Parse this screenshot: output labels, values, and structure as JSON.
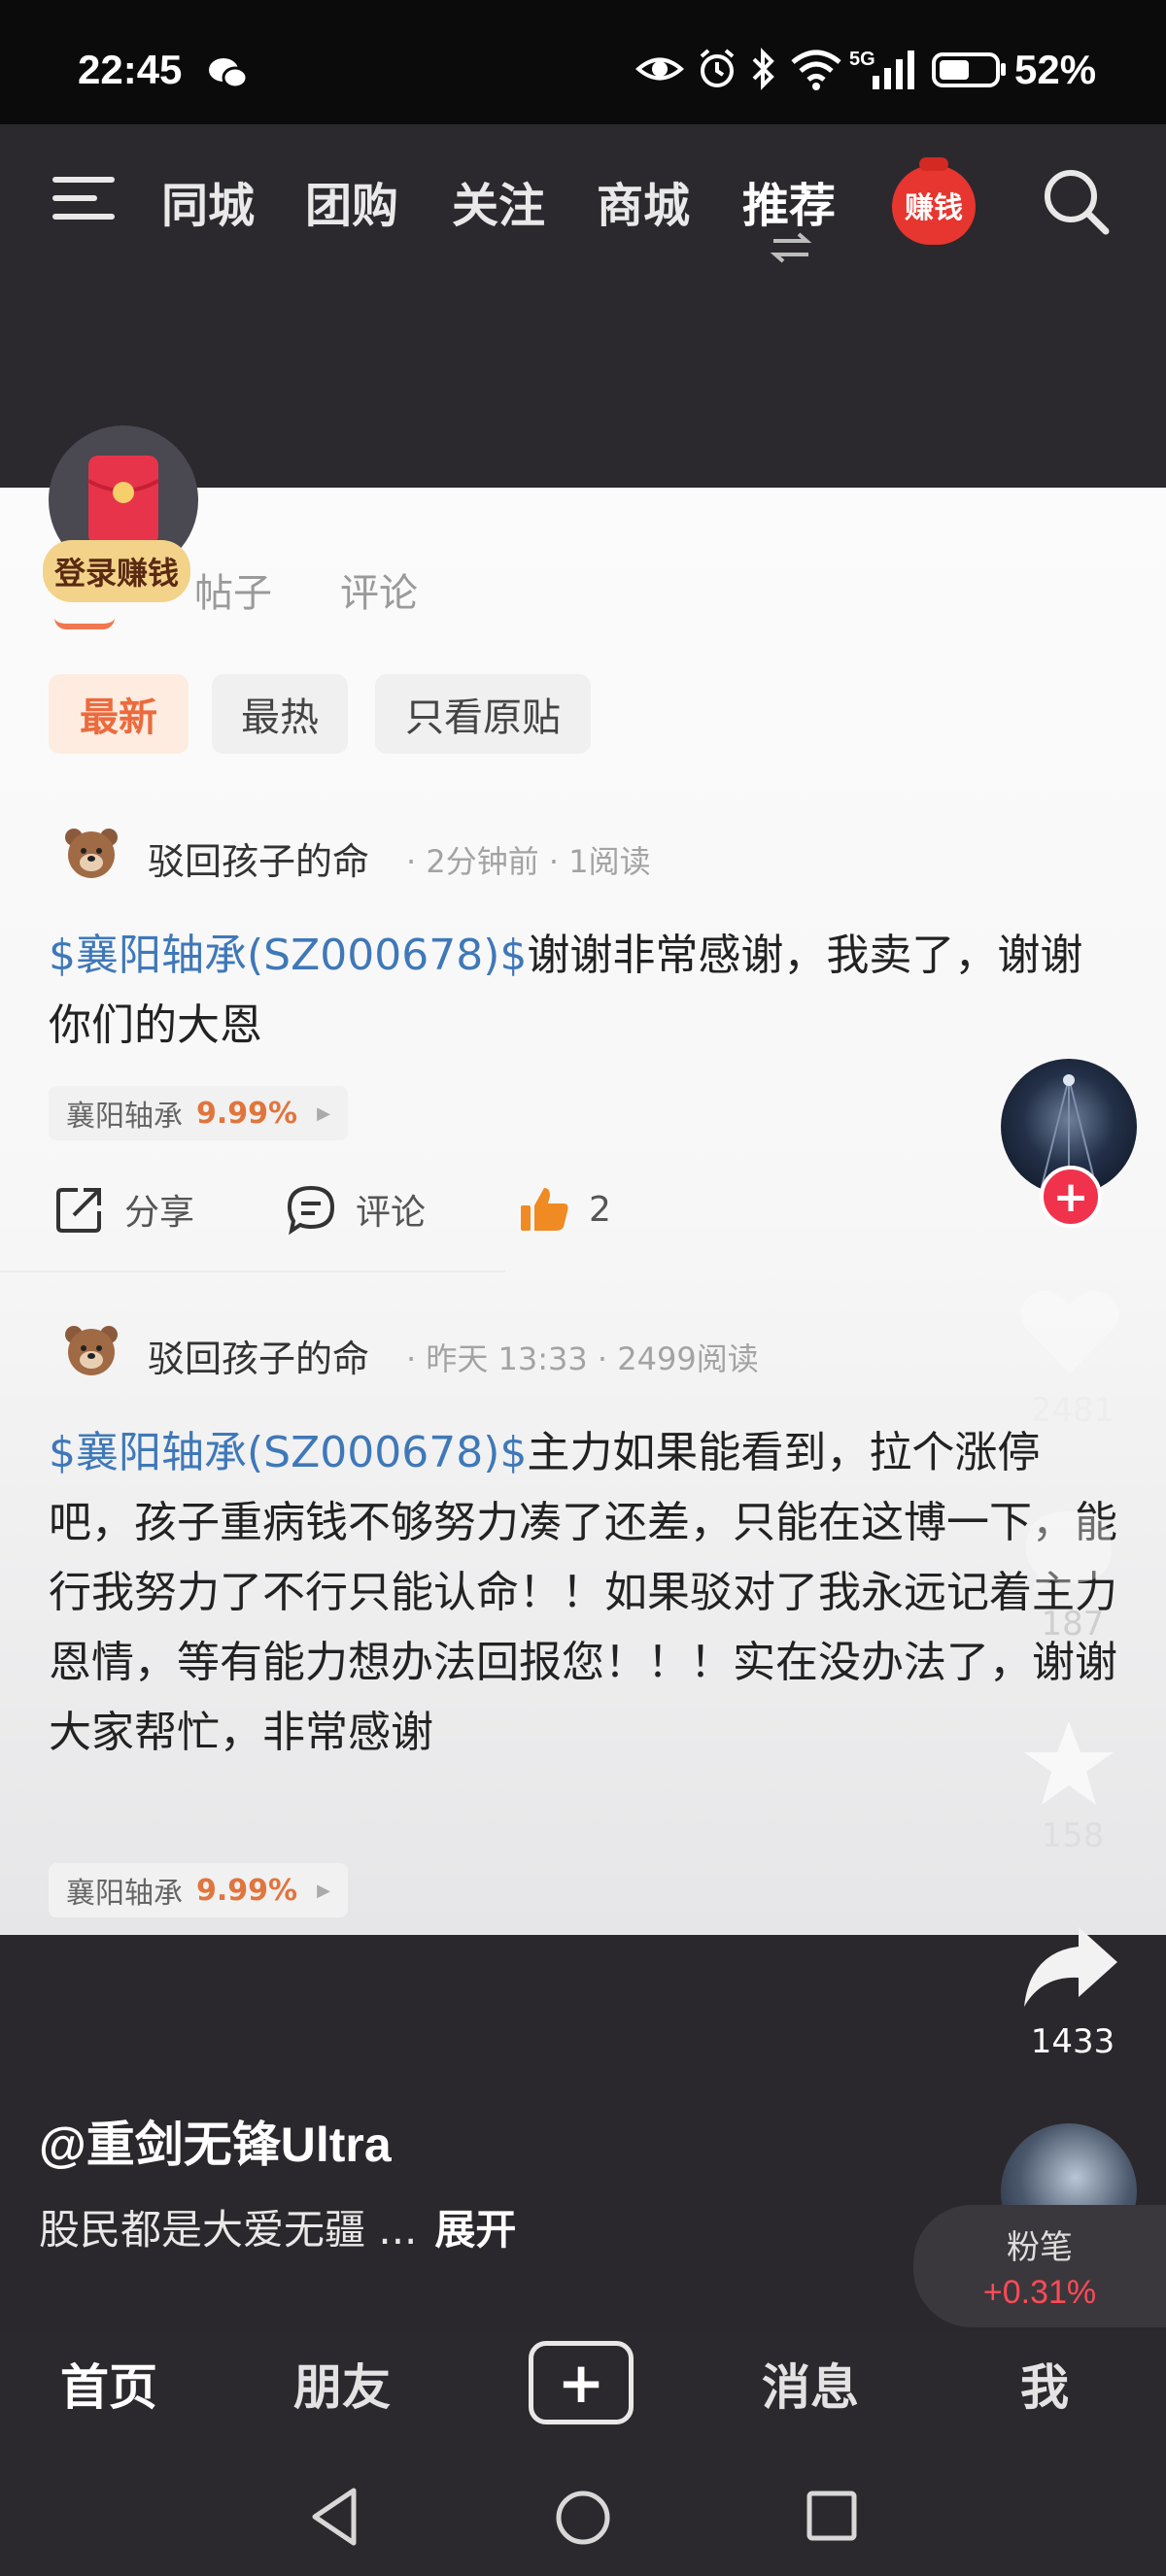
{
  "status_bar": {
    "time": "22:45",
    "network": "5G",
    "battery": "52%",
    "icons": [
      "wechat-icon",
      "eye-icon",
      "alarm-icon",
      "bluetooth-icon",
      "wifi-icon",
      "signal-icon",
      "battery-icon"
    ]
  },
  "top_nav": {
    "tabs": [
      "同城",
      "团购",
      "关注",
      "商城",
      "推荐"
    ],
    "active_tab": "推荐",
    "earn_badge": "赚钱"
  },
  "login_overlay": {
    "label": "登录赚钱"
  },
  "panel": {
    "tabs": [
      "帖子",
      "评论"
    ],
    "filters": [
      "最新",
      "最热",
      "只看原贴"
    ],
    "posts": [
      {
        "author": "驳回孩子的命",
        "meta": "· 2分钟前 · 1阅读",
        "cashtag": "$襄阳轴承(SZ000678)$",
        "text": "谢谢非常感谢，我卖了，谢谢你们的大恩",
        "stock_name": "襄阳轴承",
        "stock_pct": "9.99%",
        "share_label": "分享",
        "comment_label": "评论",
        "like_count": "2"
      },
      {
        "author": "驳回孩子的命",
        "meta": "· 昨天 13:33 · 2499阅读",
        "cashtag": "$襄阳轴承(SZ000678)$",
        "text": "主力如果能看到，拉个涨停吧，孩子重病钱不够努力凑了还差，只能在这博一下，能行我努力了不行只能认命！！如果驳对了我永远记着主力恩情，等有能力想办法回报您！！！实在没办法了，谢谢大家帮忙，非常感谢",
        "stock_name": "襄阳轴承",
        "stock_pct": "9.99%"
      }
    ]
  },
  "right_rail": {
    "follow_symbol": "+",
    "likes": "2481",
    "comments": "187",
    "favorites": "158",
    "shares": "1433"
  },
  "caption": {
    "author": "@重剑无锋Ultra",
    "text": "股民都是大爱无疆 ...",
    "more": "展开"
  },
  "stock_card": {
    "name": "粉笔",
    "pct": "+0.31%"
  },
  "bottom_nav": {
    "home": "首页",
    "friends": "朋友",
    "plus": "+",
    "messages": "消息",
    "me": "我"
  }
}
